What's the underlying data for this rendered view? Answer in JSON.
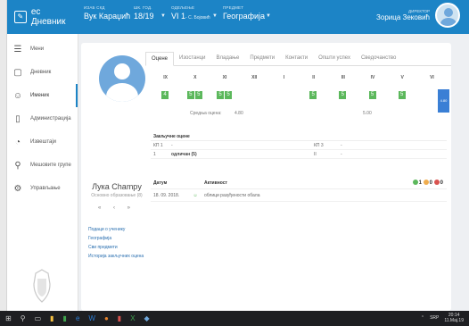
{
  "app": {
    "brand": "ес Дневник"
  },
  "topbar": {
    "school_label": "ИЗАБ СКД",
    "school_value": "Вук Караџић",
    "year_label": "ШК. ГОД.",
    "year_value": "18/19",
    "class_label": "ОДЕЉЕЊЕ",
    "class_value": "VI 1",
    "class_sub": "- С. Бојовић",
    "subject_label": "ПРЕДМЕТ",
    "subject_value": "Географија",
    "user_label": "ДИРЕКТОР",
    "user_name": "Зорица Зековић"
  },
  "sidebar": {
    "items": [
      {
        "label": "Мени",
        "icon": "menu-icon"
      },
      {
        "label": "Дневник",
        "icon": "book-icon"
      },
      {
        "label": "Именик",
        "icon": "people-icon"
      },
      {
        "label": "Администрација",
        "icon": "document-icon"
      },
      {
        "label": "Извештаји",
        "icon": "chart-icon"
      },
      {
        "label": "Мешовите групе",
        "icon": "group-icon"
      },
      {
        "label": "Упрaвљање",
        "icon": "settings-icon"
      }
    ]
  },
  "student": {
    "name": "Лука Champy",
    "program": "Основно образовање (8)",
    "pager": "« ‹ »",
    "links": [
      "Подаци о ученику",
      "Географија",
      "Сви предмети",
      "Историја закључних оцена"
    ]
  },
  "tabs": [
    "Оцене",
    "Изостанци",
    "Владање",
    "Предмети",
    "Контакти",
    "Општи успех",
    "Сведочанство"
  ],
  "grades": {
    "months": [
      "IX",
      "X",
      "XI",
      "XII",
      "I",
      "II",
      "III",
      "IV",
      "V",
      "VI"
    ],
    "values": [
      [
        "4"
      ],
      [
        "5",
        "5"
      ],
      [
        "5",
        "5"
      ],
      [],
      [],
      [
        "5"
      ],
      [
        "5"
      ],
      [
        "5"
      ],
      [
        "5"
      ],
      []
    ],
    "avg_label": "Средња оцена:",
    "avg1": "4.80",
    "avg2": "5.00",
    "side_value": "4.80"
  },
  "final": {
    "title": "Закључне оцене",
    "rows": [
      [
        "КП 1",
        "-",
        "КП 3",
        "-"
      ],
      [
        "1",
        "одличан (5)",
        "II",
        "-"
      ]
    ]
  },
  "activity": {
    "col_date": "Датум",
    "col_activity": "Активност",
    "legend": [
      "1",
      "0",
      "0"
    ],
    "rows": [
      {
        "date": "18. 09. 2018.",
        "text": "облици разуђености обала"
      }
    ]
  },
  "taskbar": {
    "time": "20:14",
    "date": "11.Мај.19",
    "lang": "SRP"
  }
}
